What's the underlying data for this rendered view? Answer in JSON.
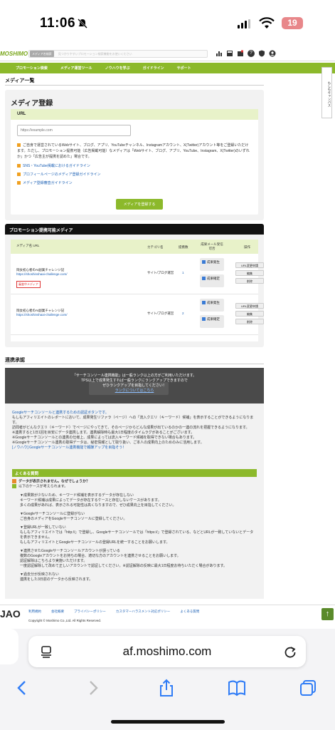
{
  "status_bar": {
    "time": "11:06",
    "battery": "19"
  },
  "header": {
    "logo": "MOSHIMO",
    "search_scope": "メディア名検索",
    "search_placeholder": "見つかりやすいプロモーション検索機能をお使いください"
  },
  "nav": {
    "items": [
      "プロモーション検索",
      "メディア運営ツール",
      "ノウハウを学ぶ",
      "ガイドライン",
      "サポート"
    ]
  },
  "side_tab": "もしもキャンパス",
  "page": {
    "heading": "メディア一覧"
  },
  "register": {
    "title": "メディア登録",
    "url_label": "URL",
    "url_placeholder": "https://example.com",
    "note": "ご自身で運営されているWebサイト、ブログ、アプリ、YouTubeチャンネル、Instagramアカウント、X(Twitter)アカウント等をご登録いただけます。ただし、プロモーション提携可能（広告掲載可能）なメディアは「Webサイト、ブログ、アプリ、YouTube、Instagram、X(Twitter)のいずれか」かつ「広告主が提携を認めた」場合です。",
    "links": [
      "SNS・YouTube掲載におけるガイドライン",
      "プロフィールページのメディア登録ガイドライン",
      "メディア登録審査ガイドライン"
    ],
    "button": "メディアを登録する"
  },
  "promo_media": {
    "title": "プロモーション提携可能メディア",
    "columns": [
      "メディア名 URL",
      "カテゴリ名",
      "提携数",
      "成果メール受信可否",
      "操作"
    ],
    "rows": [
      {
        "name": "岡女初心者のAI副業チャレンジ記",
        "url": "https://shoshinshaai-challenge.com/",
        "tag": "審査中メディア",
        "category": "サイト/ブログ運営",
        "count": "1",
        "checks": [
          "成果発生",
          "成果確定"
        ],
        "buttons": [
          "URL変更申請",
          "編集",
          "削除"
        ]
      },
      {
        "name": "岡女初心者のAI副業チャレンジ記",
        "url": "https://shoshinshaai-challenge.com/",
        "tag": "",
        "category": "サイト/ブログ運営",
        "count": "2",
        "checks": [
          "成果発生",
          "成果確定"
        ],
        "buttons": [
          "URL変更申請",
          "編集",
          "削除"
        ]
      }
    ]
  },
  "linkage": {
    "heading": "連携承認",
    "panel_line1": "「サーチコンソール連携機能」は一般ランク以上の方がご利用いただけます。",
    "panel_line2": "TPS以上で成果発生すれば一般ランクにランクアップできますので",
    "panel_line3": "ぜひランクアップを目指してください！",
    "panel_link": "ランクについてはこちら",
    "body1": "Googleサーチコンソールと連携するための認証ボタンです。",
    "body2": "もしもアフィリエイトのレポートにおいて、成果発生リファラ（ページ）への「流入クエリ（キーワード）候補」を表示することができるようになります。",
    "body3": "訪問者がどんなクエリ（キーワード）でページにやってきて、そのページからどんな成果が出ているのかの一連の流れを把握できるようになります。",
    "body4": "※連携すると1日1回を目安にデータ連携します。連携解除時も最大1日程度のタイムラグがあることがございます。",
    "body5": "※Googleサーチコンソールとの連携の仕様上、成果によっては流入キーワード候補を取得できない場合もあります。",
    "body6": "※Googleサーチコンソール連携の取得データは、秘密情報として取り扱い、ご本人の成果向上のためのみに活用します。",
    "body7": "[ノウハウ] Googleサーチコンソール連携機能で報酬アップを目指そう！",
    "faq_title": "よくある質問",
    "faq_q": "データが表示されません。なぜでしょうか？",
    "faq_a": "以下のケースが考えられます。",
    "faq_items": [
      "▼成果数が少ないため、キーワード候補を表示するデータが存在しない\nキーワード候補は成果によってデータが存在するケースと存在しないケースがあります。\n多くの成果があれば、表示される可能性は高くなりますので、ぜひ成果向上を目指してください。",
      "▼Googleサーチコンソールに登録がない\nご自身のメディアをGoogleサーチコンソールに登録してください。",
      "▼登録URLが一致していない\nもしもアフィリエイトでは「http://」で登録し、Googleサーチコンソールでは「https://」で登録されている、などとURLが一致していないとデータを表示できません。\nもしもアフィリエイトとGoogleサーチコンソールの登録URLを統一することをお願いします。",
      "▼連携させたGoogleサーチコンソールアカウントが誤っている\n複数のGoogleアカウントをお持ちの場合、適切な方のアカウントを連携させることをお願いします。\n認証解除はこちらより実施いただけます。\n一度認証解除して改めて正しいアカウントで認証してください。※認証解除の反映に最大1日程度お待ちいただく場合があります。",
      "▼過去分が反映されない\n連携をした3日前のデータから反映されます。"
    ]
  },
  "footer": {
    "logo": "JAO",
    "links": [
      "利用規約",
      "会社概要",
      "プライバシーポリシー",
      "カスタマーハラスメント対応ポリシー",
      "よくある質問"
    ],
    "copyright": "Copyright © Moshimo Co.,Ltd. All Rights Reserved."
  },
  "safari": {
    "host": "af.moshimo.com"
  }
}
